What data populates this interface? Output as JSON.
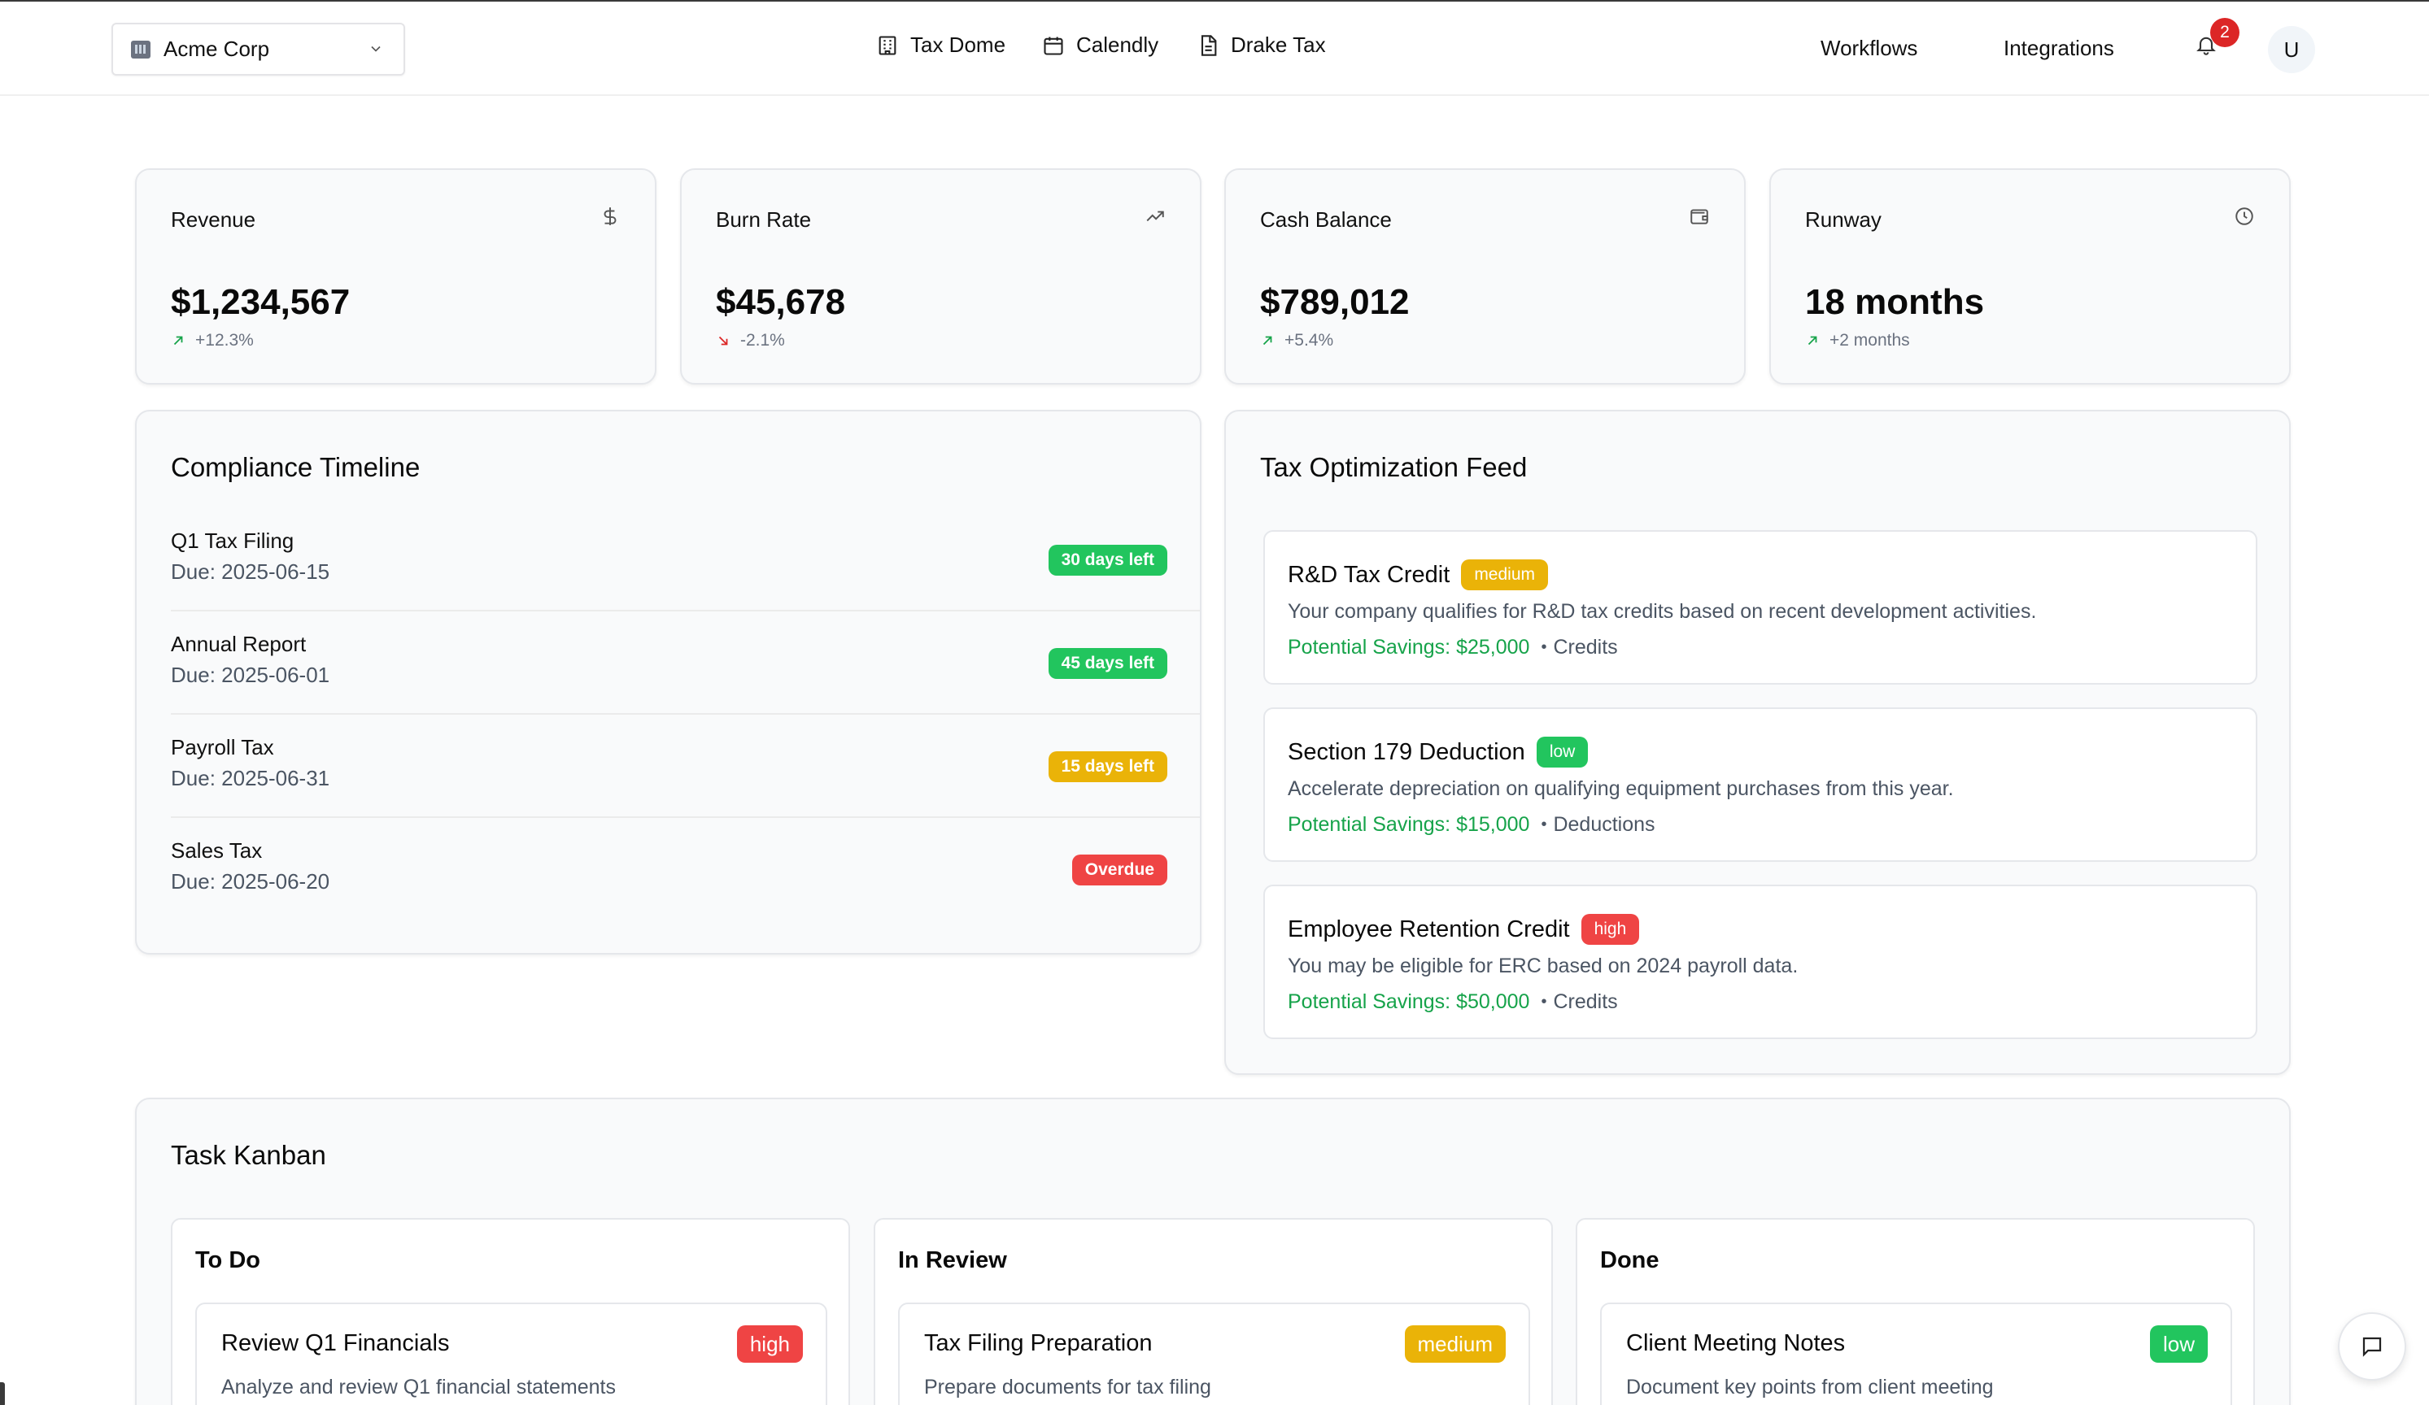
{
  "header": {
    "company": "Acme Corp",
    "links": [
      {
        "label": "Tax Dome",
        "icon": "building-icon"
      },
      {
        "label": "Calendly",
        "icon": "calendar-icon"
      },
      {
        "label": "Drake Tax",
        "icon": "file-text-icon"
      }
    ],
    "nav": [
      "Workflows",
      "Integrations"
    ],
    "notification_count": "2",
    "avatar_initial": "U"
  },
  "metrics": [
    {
      "label": "Revenue",
      "value": "$1,234,567",
      "change": "+12.3%",
      "trend": "up",
      "icon": "dollar-icon"
    },
    {
      "label": "Burn Rate",
      "value": "$45,678",
      "change": "-2.1%",
      "trend": "down",
      "icon": "trending-up-icon"
    },
    {
      "label": "Cash Balance",
      "value": "$789,012",
      "change": "+5.4%",
      "trend": "up",
      "icon": "wallet-icon"
    },
    {
      "label": "Runway",
      "value": "18 months",
      "change": "+2 months",
      "trend": "up",
      "icon": "clock-icon"
    }
  ],
  "compliance": {
    "title": "Compliance Timeline",
    "items": [
      {
        "title": "Q1 Tax Filing",
        "due": "Due: 2025-06-15",
        "badge": "30 days left",
        "color": "#22c55e"
      },
      {
        "title": "Annual Report",
        "due": "Due: 2025-06-01",
        "badge": "45 days left",
        "color": "#22c55e"
      },
      {
        "title": "Payroll Tax",
        "due": "Due: 2025-06-31",
        "badge": "15 days left",
        "color": "#eab308"
      },
      {
        "title": "Sales Tax",
        "due": "Due: 2025-06-20",
        "badge": "Overdue",
        "color": "#ef4444"
      }
    ]
  },
  "feed": {
    "title": "Tax Optimization Feed",
    "items": [
      {
        "title": "R&D Tax Credit",
        "priority": "medium",
        "color": "#eab308",
        "description": "Your company qualifies for R&D tax credits based on recent development activities.",
        "savings": "Potential Savings: $25,000",
        "category": "Credits"
      },
      {
        "title": "Section 179 Deduction",
        "priority": "low",
        "color": "#22c55e",
        "description": "Accelerate depreciation on qualifying equipment purchases from this year.",
        "savings": "Potential Savings: $15,000",
        "category": "Deductions"
      },
      {
        "title": "Employee Retention Credit",
        "priority": "high",
        "color": "#ef4444",
        "description": "You may be eligible for ERC based on 2024 payroll data.",
        "savings": "Potential Savings: $50,000",
        "category": "Credits"
      }
    ]
  },
  "kanban": {
    "title": "Task Kanban",
    "columns": [
      {
        "title": "To Do",
        "card": {
          "title": "Review Q1 Financials",
          "priority": "high",
          "color": "#ef4444",
          "description": "Analyze and review Q1 financial statements"
        }
      },
      {
        "title": "In Review",
        "card": {
          "title": "Tax Filing Preparation",
          "priority": "medium",
          "color": "#eab308",
          "description": "Prepare documents for tax filing"
        }
      },
      {
        "title": "Done",
        "card": {
          "title": "Client Meeting Notes",
          "priority": "low",
          "color": "#22c55e",
          "description": "Document key points from client meeting"
        }
      }
    ]
  },
  "colors": {
    "positive": "#16a34a",
    "negative": "#dc2626",
    "accent": "#111111"
  }
}
